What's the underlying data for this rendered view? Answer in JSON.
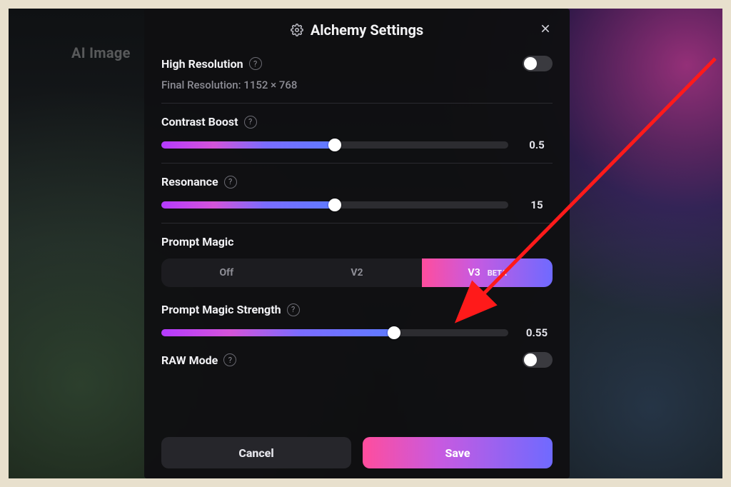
{
  "background": {
    "label": "AI Image"
  },
  "modal": {
    "title": "Alchemy Settings",
    "close_icon": "close"
  },
  "high_resolution": {
    "label": "High Resolution",
    "subtext": "Final Resolution: 1152 × 768",
    "enabled": true
  },
  "contrast_boost": {
    "label": "Contrast Boost",
    "value": "0.5",
    "percent": 50
  },
  "resonance": {
    "label": "Resonance",
    "value": "15",
    "percent": 50
  },
  "prompt_magic": {
    "label": "Prompt Magic",
    "options": [
      {
        "label": "Off",
        "active": false
      },
      {
        "label": "V2",
        "active": false
      },
      {
        "label": "V3",
        "badge": "BETA",
        "active": true
      }
    ]
  },
  "prompt_magic_strength": {
    "label": "Prompt Magic Strength",
    "value": "0.55",
    "percent": 67
  },
  "raw_mode": {
    "label": "RAW Mode",
    "enabled": false
  },
  "footer": {
    "cancel": "Cancel",
    "save": "Save"
  },
  "colors": {
    "accent_gradient_from": "#ff4d9d",
    "accent_gradient_to": "#6f6aff",
    "arrow": "#ff1a1a"
  }
}
